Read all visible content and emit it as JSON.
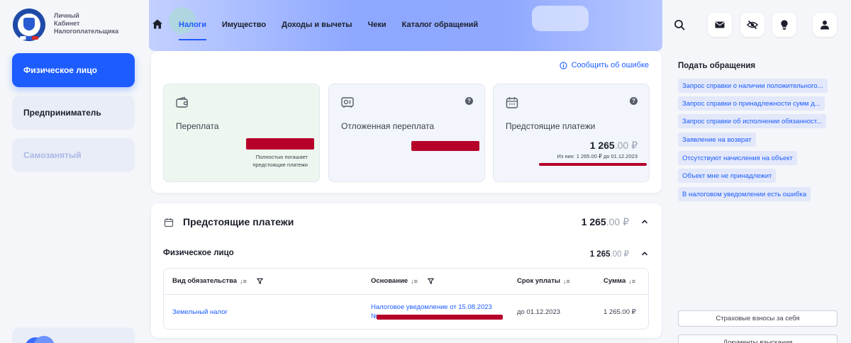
{
  "logo": {
    "line1": "Личный",
    "line2": "Кабинет",
    "line3": "Налогоплательщика"
  },
  "nav": {
    "items": [
      "Налоги",
      "Имущество",
      "Доходы и вычеты",
      "Чеки",
      "Каталог обращений"
    ],
    "active": "Налоги"
  },
  "sidebar": {
    "items": [
      "Физическое лицо",
      "Предприниматель",
      "Самозанятый"
    ],
    "active": "Физическое лицо"
  },
  "summary": {
    "report_error": "Сообщить об ошибке",
    "overpayment": {
      "title": "Переплата",
      "note_line1": "Полностью погашает",
      "note_line2": "предстоящие платежи"
    },
    "deferred": {
      "title": "Отложенная переплата"
    },
    "upcoming": {
      "title": "Предстоящие платежи",
      "amount_main": "1 265",
      "amount_cents": ".00 ₽",
      "detail": "Из них: 1 265.00 ₽ до 01.12.2023"
    },
    "help_glyph": "?"
  },
  "payments": {
    "title": "Предстоящие платежи",
    "total_main": "1 265",
    "total_cents": ".00 ₽",
    "section": {
      "title": "Физическое лицо",
      "total_main": "1 265",
      "total_cents": ".00 ₽"
    },
    "table": {
      "columns": [
        "Вид обязательства",
        "Основание",
        "Срок уплаты",
        "Сумма"
      ],
      "sort_glyph": "↓≡",
      "rows": [
        {
          "type": "Земельный налог",
          "basis_line1": "Налоговое уведомление от 15.08.2023",
          "basis_line2": "№",
          "due": "до 01.12.2023",
          "sum": "1 265.00 ₽"
        }
      ]
    }
  },
  "requests": {
    "title": "Подать обращения",
    "items": [
      "Запрос справки о наличии положительного...",
      "Запрос справки о принадлежности сумм д...",
      "Запрос справки об исполнении обязанност...",
      "Заявление на возврат",
      "Отсутствуют начисления на объект",
      "Объект мне не принадлежит",
      "В налоговом уведомлении есть ошибка"
    ],
    "buttons": [
      "Страховые взносы за себя",
      "Документы взыскания"
    ]
  },
  "colors": {
    "accent": "#1d5cff",
    "redaction": "#b6002a"
  }
}
